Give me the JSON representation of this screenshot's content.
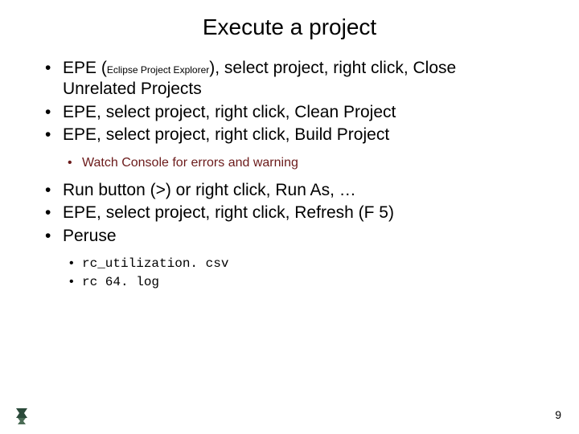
{
  "title": "Execute a project",
  "bullets1": {
    "a": {
      "pre": "EPE (",
      "sub": "Eclipse Project Explorer",
      "post": "), select project, right click, Close Unrelated Projects"
    },
    "b": "EPE, select project, right click, Clean Project",
    "c": "EPE, select project, right click, Build Project"
  },
  "sub1": {
    "a": "Watch Console for errors and warning"
  },
  "bullets2": {
    "a": "Run button (>) or right click, Run As, …",
    "b": "EPE, select project, right click, Refresh (F 5)",
    "c": "Peruse"
  },
  "sub2": {
    "a": "rc_utilization. csv",
    "b": "rc 64. log"
  },
  "page": "9"
}
